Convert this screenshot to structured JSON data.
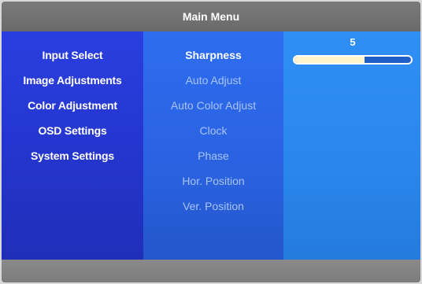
{
  "title": "Main Menu",
  "left_menu": [
    {
      "label": "Input Select"
    },
    {
      "label": "Image Adjustments"
    },
    {
      "label": "Color Adjustment"
    },
    {
      "label": "OSD Settings"
    },
    {
      "label": "System Settings"
    }
  ],
  "submenu": [
    {
      "label": "Sharpness",
      "active": true
    },
    {
      "label": "Auto Adjust"
    },
    {
      "label": "Auto Color Adjust"
    },
    {
      "label": "Clock"
    },
    {
      "label": "Phase"
    },
    {
      "label": "Hor. Position"
    },
    {
      "label": "Ver. Position"
    }
  ],
  "setting": {
    "value": "5",
    "fill_fraction": 0.6
  },
  "colors": {
    "left_panel": "#2536cf",
    "mid_panel": "#2a62e0",
    "right_panel": "#2a86ec",
    "slider_fill": "#fff4cc"
  }
}
